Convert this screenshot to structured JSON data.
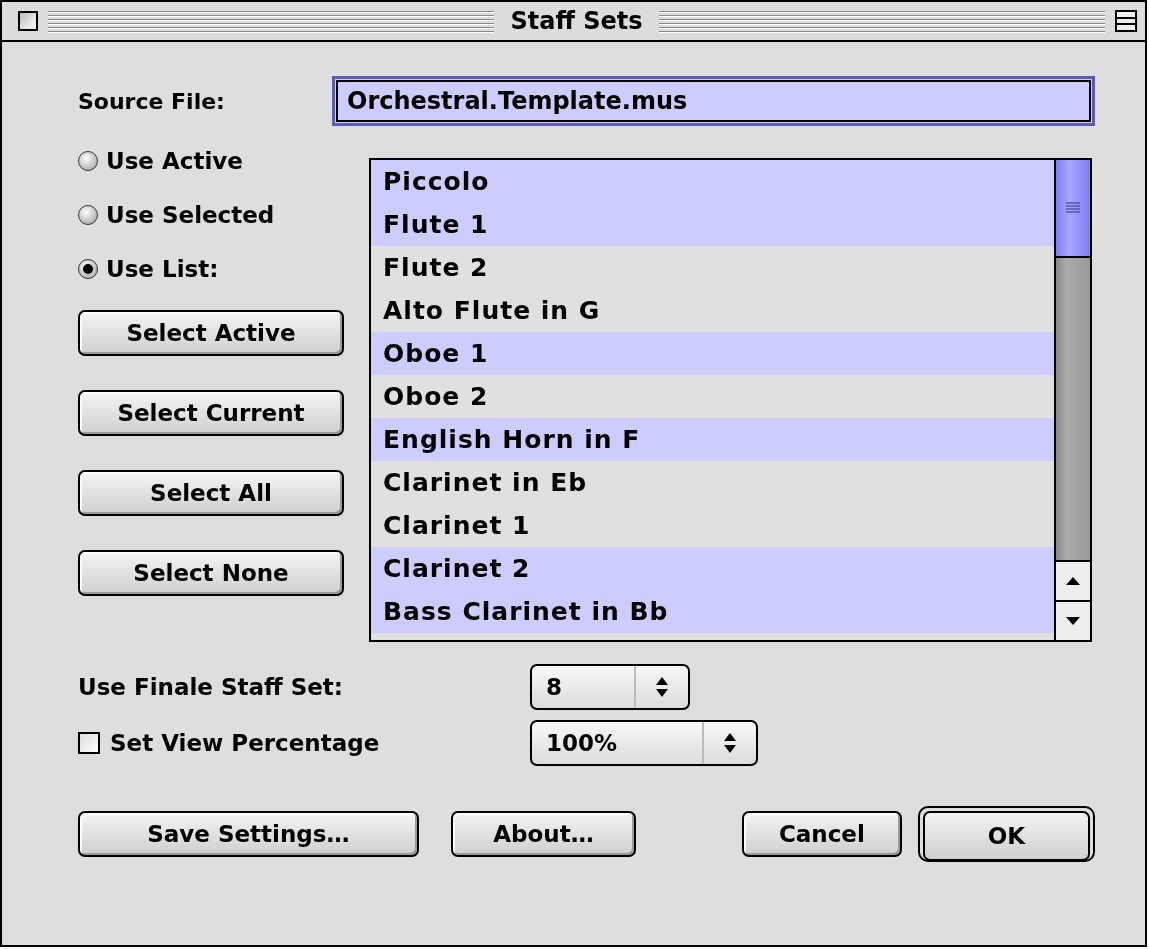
{
  "window": {
    "title": "Staff Sets"
  },
  "source_file": {
    "label": "Source File:",
    "value": "Orchestral.Template.mus"
  },
  "source_options": [
    {
      "label": "Use Active",
      "selected": false
    },
    {
      "label": "Use Selected",
      "selected": false
    },
    {
      "label": "Use List:",
      "selected": true
    }
  ],
  "select_buttons": [
    "Select Active",
    "Select Current",
    "Select All",
    "Select None"
  ],
  "staff_list": {
    "items": [
      {
        "label": "Piccolo",
        "selected": true
      },
      {
        "label": "Flute 1",
        "selected": true
      },
      {
        "label": "Flute 2",
        "selected": false
      },
      {
        "label": "Alto Flute in G",
        "selected": false
      },
      {
        "label": "Oboe 1",
        "selected": true
      },
      {
        "label": "Oboe 2",
        "selected": false
      },
      {
        "label": "English Horn in F",
        "selected": true
      },
      {
        "label": "Clarinet in Eb",
        "selected": false
      },
      {
        "label": "Clarinet 1",
        "selected": false
      },
      {
        "label": "Clarinet 2",
        "selected": true
      },
      {
        "label": "Bass Clarinet in Bb",
        "selected": true
      }
    ]
  },
  "staff_set": {
    "label": "Use Finale Staff Set:",
    "value": "8"
  },
  "view_percentage": {
    "label": "Set View Percentage",
    "checked": false,
    "value": "100%"
  },
  "buttons": [
    {
      "label": "Save Settings…",
      "default": false
    },
    {
      "label": "About…",
      "default": false
    },
    {
      "label": "Cancel",
      "default": false
    },
    {
      "label": "OK",
      "default": true
    }
  ]
}
